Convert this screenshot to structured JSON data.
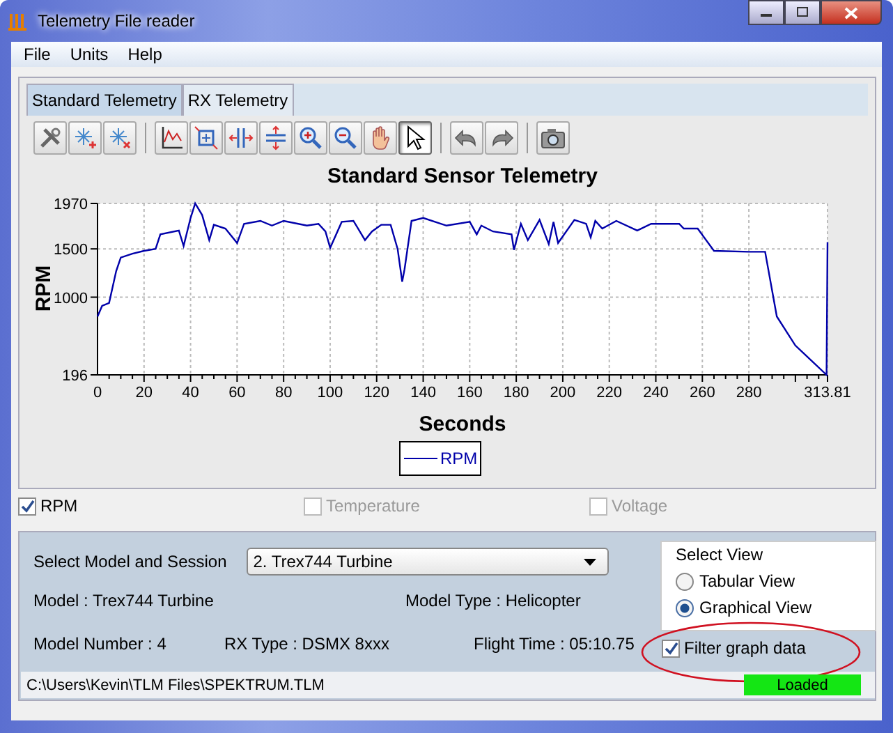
{
  "window": {
    "title": "Telemetry File reader"
  },
  "menu": [
    "File",
    "Units",
    "Help"
  ],
  "tabs": [
    {
      "label": "Standard Telemetry",
      "selected": true
    },
    {
      "label": "RX Telemetry",
      "selected": false
    }
  ],
  "toolbar": [
    [
      {
        "kind": "settings",
        "selected": false
      },
      {
        "kind": "add-point",
        "selected": false
      },
      {
        "kind": "remove-point",
        "selected": false
      }
    ],
    [
      {
        "kind": "axis",
        "selected": false
      },
      {
        "kind": "zoom-box",
        "selected": false
      },
      {
        "kind": "fit-horizontal",
        "selected": false
      },
      {
        "kind": "fit-vertical",
        "selected": false
      },
      {
        "kind": "zoom-in",
        "selected": false
      },
      {
        "kind": "zoom-out",
        "selected": false
      },
      {
        "kind": "pan",
        "selected": false
      },
      {
        "kind": "pointer",
        "selected": true
      }
    ],
    [
      {
        "kind": "undo",
        "selected": false
      },
      {
        "kind": "redo",
        "selected": false
      }
    ],
    [
      {
        "kind": "camera",
        "selected": false
      }
    ]
  ],
  "chart_data": {
    "type": "line",
    "title": "Standard Sensor Telemetry",
    "xlabel": "Seconds",
    "ylabel": "RPM",
    "x": [
      0,
      2,
      5,
      8,
      10,
      15,
      20,
      25,
      27,
      35,
      37,
      40,
      42,
      45,
      48,
      50,
      55,
      60,
      63,
      70,
      75,
      80,
      90,
      95,
      98,
      100,
      105,
      110,
      115,
      118,
      122,
      126,
      129,
      131,
      132,
      135,
      140,
      150,
      160,
      163,
      165,
      170,
      178,
      179,
      182,
      185,
      190,
      194,
      196,
      198,
      205,
      210,
      212,
      214,
      217,
      223,
      232,
      238,
      250,
      252,
      258,
      265,
      280,
      287,
      292,
      300,
      313.4,
      313.81
    ],
    "series": [
      {
        "name": "RPM",
        "color": "#0000aa",
        "values": [
          800,
          910,
          940,
          1270,
          1410,
          1450,
          1480,
          1500,
          1650,
          1690,
          1530,
          1820,
          1970,
          1850,
          1590,
          1750,
          1710,
          1560,
          1760,
          1790,
          1740,
          1790,
          1740,
          1760,
          1680,
          1510,
          1780,
          1790,
          1590,
          1680,
          1750,
          1750,
          1500,
          1160,
          1290,
          1790,
          1820,
          1740,
          1780,
          1650,
          1740,
          1680,
          1650,
          1490,
          1760,
          1590,
          1800,
          1550,
          1780,
          1560,
          1800,
          1760,
          1620,
          1790,
          1710,
          1790,
          1690,
          1760,
          1760,
          1710,
          1710,
          1480,
          1470,
          1470,
          800,
          500,
          196,
          1570
        ]
      }
    ],
    "grid": true,
    "xlim": [
      0,
      313.81
    ],
    "ylim": [
      196,
      1970
    ],
    "xticks": [
      0,
      20,
      40,
      60,
      80,
      100,
      120,
      140,
      160,
      180,
      200,
      220,
      240,
      260,
      280,
      313.81
    ],
    "yticks": [
      196,
      1000,
      1500,
      1970
    ]
  },
  "series_toggles": [
    {
      "label": "RPM",
      "checked": true,
      "disabled": false
    },
    {
      "label": "Temperature",
      "checked": false,
      "disabled": true
    },
    {
      "label": "Voltage",
      "checked": false,
      "disabled": true
    }
  ],
  "session": {
    "label": "Select Model and Session",
    "value": "2. Trex744 Turbine",
    "model": "Model : Trex744 Turbine",
    "model_type": "Model Type : Helicopter",
    "model_number": "Model Number : 4",
    "rx_type": "RX Type : DSMX 8xxx",
    "flight_time": "Flight Time : 05:10.75"
  },
  "select_view": {
    "title": "Select View",
    "options": [
      {
        "label": "Tabular View",
        "selected": false
      },
      {
        "label": "Graphical View",
        "selected": true
      }
    ]
  },
  "filter": {
    "label": "Filter graph data",
    "checked": true
  },
  "status_bar": {
    "path": "C:\\Users\\Kevin\\TLM Files\\SPEKTRUM.TLM",
    "progress": {
      "label": "Loaded",
      "level": 1
    }
  }
}
